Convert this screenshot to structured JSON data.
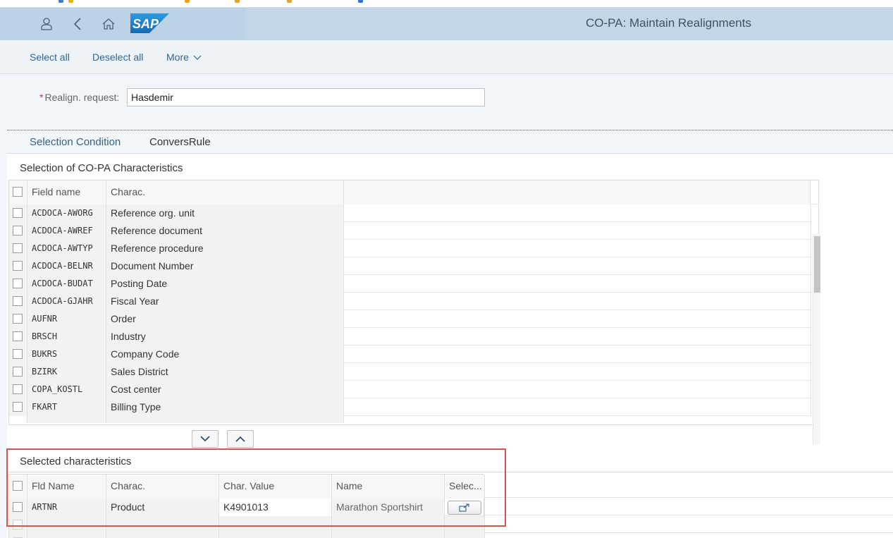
{
  "app": {
    "title": "CO-PA: Maintain Realignments",
    "logo_text": "SAP"
  },
  "shell": {
    "icons": [
      "user-icon",
      "back-icon",
      "home-icon"
    ]
  },
  "toolbar": {
    "select_all": "Select all",
    "deselect_all": "Deselect all",
    "more": "More"
  },
  "request": {
    "label": "Realign. request:",
    "required_mark": "*",
    "value": "Hasdemir"
  },
  "tabs": [
    {
      "label": "Selection Condition",
      "active": true
    },
    {
      "label": "ConversRule",
      "active": false
    }
  ],
  "characteristics": {
    "title": "Selection of CO-PA Characteristics",
    "columns": [
      "Field name",
      "Charac."
    ],
    "rows": [
      {
        "field": "ACDOCA-AWORG",
        "charac": "Reference org. unit"
      },
      {
        "field": "ACDOCA-AWREF",
        "charac": "Reference document"
      },
      {
        "field": "ACDOCA-AWTYP",
        "charac": "Reference procedure"
      },
      {
        "field": "ACDOCA-BELNR",
        "charac": "Document Number"
      },
      {
        "field": "ACDOCA-BUDAT",
        "charac": "Posting Date"
      },
      {
        "field": "ACDOCA-GJAHR",
        "charac": "Fiscal Year"
      },
      {
        "field": "AUFNR",
        "charac": "Order"
      },
      {
        "field": "BRSCH",
        "charac": "Industry"
      },
      {
        "field": "BUKRS",
        "charac": "Company Code"
      },
      {
        "field": "BZIRK",
        "charac": "Sales District"
      },
      {
        "field": "COPA_KOSTL",
        "charac": "Cost center"
      },
      {
        "field": "FKART",
        "charac": "Billing Type"
      }
    ]
  },
  "selected": {
    "title": "Selected characteristics",
    "columns": [
      "Fld Name",
      "Charac.",
      "Char. Value",
      "Name",
      "Selec..."
    ],
    "rows": [
      {
        "field": "ARTNR",
        "charac": "Product",
        "value": "K4901013",
        "name": "Marathon Sportshirt"
      }
    ]
  },
  "colors": {
    "shell": "#bcd2e6",
    "accent": "#346187",
    "link": "#2f6497",
    "highlight_box": "#d9534f"
  }
}
